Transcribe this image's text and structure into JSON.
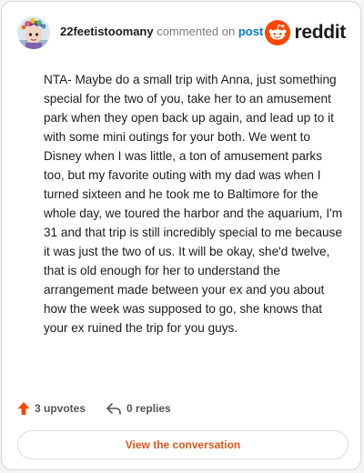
{
  "comment": {
    "username": "22feetistoomany",
    "commented_text": "commented on",
    "post_link": "post",
    "body": "NTA- Maybe do a small trip with Anna, just something special for the two of you, take her to an amusement park when they open back up again, and lead up to it with some mini outings for your both. We went to Disney when I was little, a ton of amusement parks too, but my favorite outing with my dad was when I turned sixteen and he took me to Baltimore for the whole day, we toured the harbor and the aquarium, I'm 31 and that trip is still incredibly special to me because it was just the two of us. It will be okay, she'd twelve, that is old enough for her to understand the arrangement made between your ex and you about how the week was supposed to go, she knows that your ex ruined the trip for you guys."
  },
  "brand": {
    "name": "reddit",
    "icon": "reddit-logo-icon",
    "color": "#ff4500"
  },
  "actions": {
    "upvotes": "3 upvotes",
    "replies": "0 replies",
    "upvote_icon": "upvote-arrow-icon",
    "reply_icon": "reply-arrow-icon",
    "upvote_color": "#ff4500"
  },
  "cta": {
    "label": "View the conversation",
    "color": "#e0561d"
  }
}
